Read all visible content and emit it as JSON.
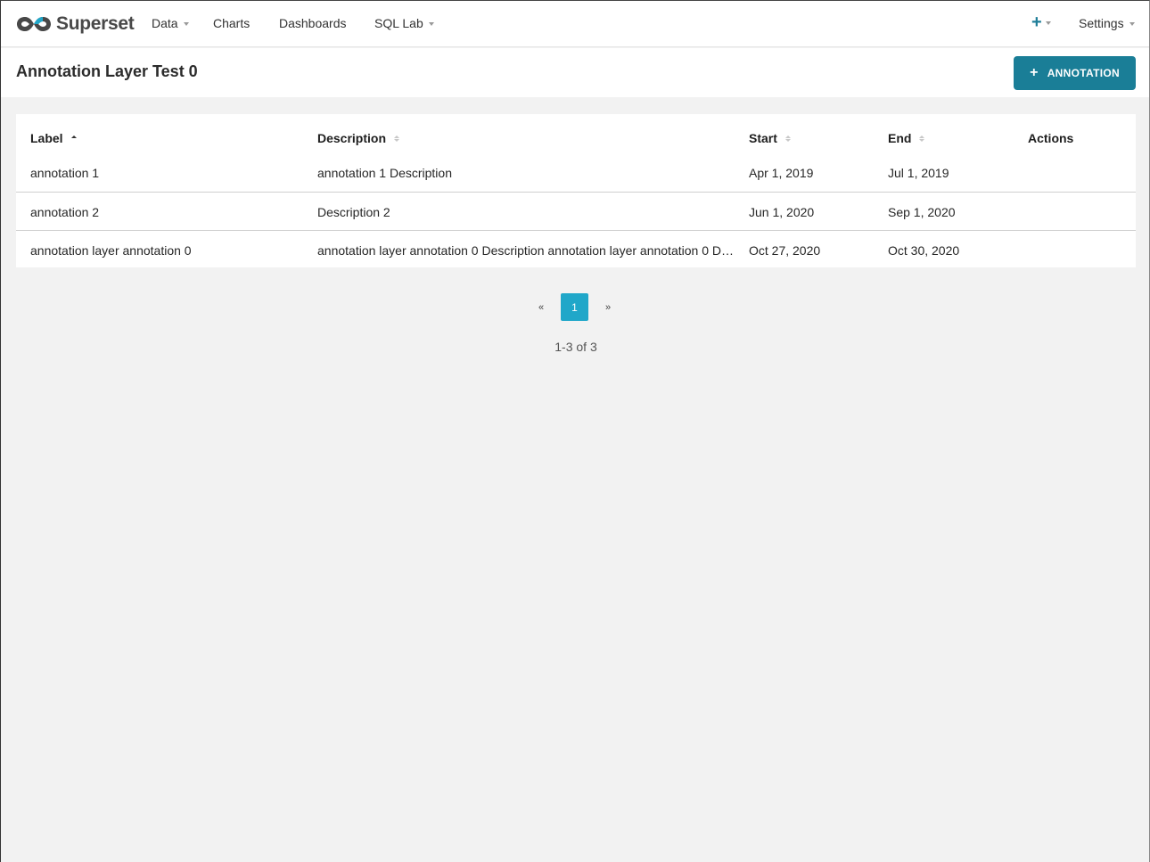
{
  "nav": {
    "brand": "Superset",
    "items": [
      {
        "label": "Data",
        "dropdown": true
      },
      {
        "label": "Charts",
        "dropdown": false
      },
      {
        "label": "Dashboards",
        "dropdown": false
      },
      {
        "label": "SQL Lab",
        "dropdown": true
      }
    ],
    "plus_icon": "plus-icon",
    "settings_label": "Settings"
  },
  "page": {
    "title": "Annotation Layer Test 0",
    "add_button_label": "ANNOTATION"
  },
  "table": {
    "columns": [
      {
        "label": "Label",
        "sortable": true,
        "sort": "asc"
      },
      {
        "label": "Description",
        "sortable": true
      },
      {
        "label": "Start",
        "sortable": true
      },
      {
        "label": "End",
        "sortable": true
      },
      {
        "label": "Actions",
        "sortable": false
      }
    ],
    "rows": [
      {
        "label": "annotation 1",
        "description": "annotation 1 Description",
        "start": "Apr 1, 2019",
        "end": "Jul 1, 2019"
      },
      {
        "label": "annotation 2",
        "description": "Description 2",
        "start": "Jun 1, 2020",
        "end": "Sep 1, 2020"
      },
      {
        "label": "annotation layer annotation 0",
        "description": "annotation layer annotation 0 Description annotation layer annotation 0 D…",
        "start": "Oct 27, 2020",
        "end": "Oct 30, 2020"
      }
    ]
  },
  "pagination": {
    "prev": "«",
    "current": "1",
    "next": "»",
    "info": "1-3 of 3"
  },
  "colors": {
    "primary": "#1a7e97",
    "page_active": "#20a7c9"
  }
}
